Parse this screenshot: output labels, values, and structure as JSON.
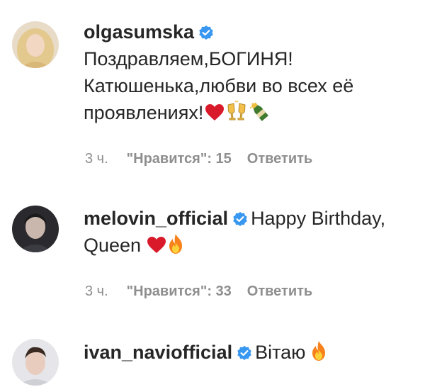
{
  "comments": [
    {
      "username": "olgasumska",
      "text_lines": [
        "Поздравляем,БОГИНЯ!",
        "Катюшенька,любви во всех её",
        "проявлениях!"
      ],
      "emojis": [
        "red-heart-icon",
        "clinking-glasses-icon",
        "champagne-bottle-icon"
      ],
      "time": "3 ч.",
      "likes": "\"Нравится\": 15",
      "reply": "Ответить"
    },
    {
      "username": "melovin_official",
      "text_lines": [
        "Happy Birthday,",
        "Queen"
      ],
      "emojis": [
        "red-heart-icon",
        "fire-icon"
      ],
      "time": "3 ч.",
      "likes": "\"Нравится\": 33",
      "reply": "Ответить"
    },
    {
      "username": "ivan_naviofficial",
      "text_lines": [
        "Вітаю"
      ],
      "emojis": [
        "fire-icon"
      ]
    }
  ],
  "colors": {
    "verified": "#3897f0",
    "meta": "#8e8e8e",
    "text": "#262626"
  }
}
